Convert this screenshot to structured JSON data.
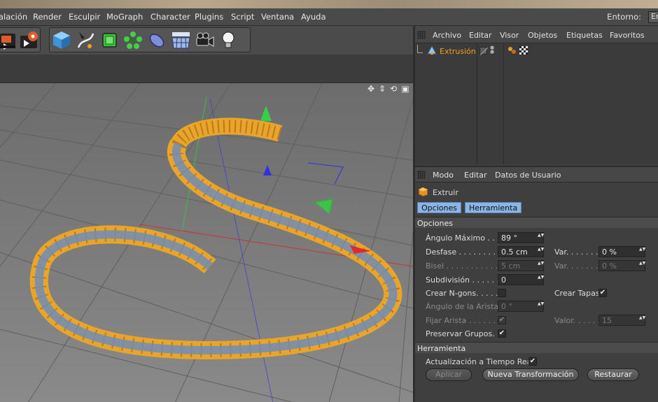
{
  "menubar": {
    "items": [
      "alación",
      "Render",
      "Esculpir",
      "MoGraph",
      "Character",
      "Plugins",
      "Script",
      "Ventana",
      "Ayuda"
    ],
    "env_label": "Entorno:",
    "env_value": "En"
  },
  "toolbar": {
    "icons": [
      "render-view-icon",
      "render-settings-icon",
      "cube-icon",
      "pen-spline-icon",
      "subdivision-icon",
      "cloner-icon",
      "deformer-icon",
      "floor-icon",
      "camera-icon",
      "light-icon"
    ]
  },
  "object_manager": {
    "menu": [
      "Archivo",
      "Editar",
      "Visor",
      "Objetos",
      "Etiquetas",
      "Favoritos"
    ],
    "object_name": "Extrusión",
    "object_color": "#f0a020"
  },
  "attributes": {
    "menu": [
      "Modo",
      "Editar",
      "Datos de Usuario"
    ],
    "object_title": "Extruir",
    "tabs": [
      "Opciones",
      "Herramienta"
    ],
    "section_options": "Opciones",
    "angulo_maximo_label": "Ángulo Máximo . . . .",
    "angulo_maximo_value": "89 °",
    "desfase_label": "Desfase . . . . . . . . .",
    "desfase_value": "0.5 cm",
    "var1_label": "Var. . . . . . . .",
    "var1_value": "0 %",
    "bisel_label": "Bisel . . . . . . . . . . .",
    "bisel_value": "5 cm",
    "var2_label": "Var. . . . . . . .",
    "var2_value": "0 %",
    "subdivision_label": "Subdivisión . . . . . .",
    "subdivision_value": "0",
    "crear_ngons_label": "Crear N-gons. . . . .",
    "crear_tapas_label": "Crear Tapas",
    "angulo_arista_label": "Ángulo de la Arista",
    "angulo_arista_value": "0 °",
    "fijar_arista_label": "Fijar Arista . . . . . .",
    "valor_label": "Valor. . . . . . .",
    "valor_value": "15",
    "preservar_label": "Preservar Grupos. .",
    "section_tool": "Herramienta",
    "realtime_label": "Actualización a Tiempo Real",
    "apply_label": "Aplicar",
    "new_transform_label": "Nueva Transformación",
    "restore_label": "Restaurar",
    "check_mark": "✔",
    "spin_glyph": "▲▼"
  },
  "colors": {
    "accent_tab": "#8ab5e6",
    "annotation_red": "#c41a1a",
    "spline_orange": "#f0a21f",
    "spline_blue": "#5d86c0"
  }
}
